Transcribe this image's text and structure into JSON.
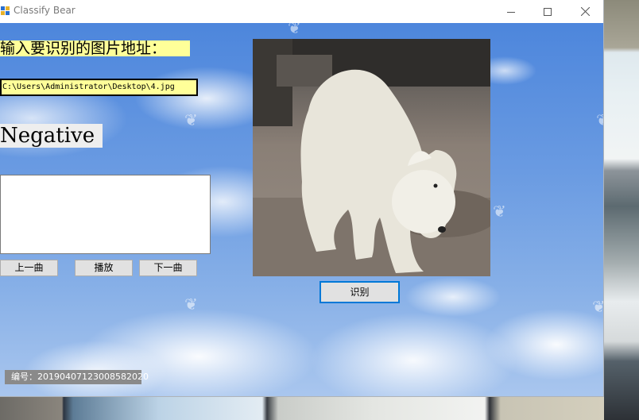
{
  "window": {
    "title": "Classify Bear",
    "minimize_icon": "minimize-icon",
    "maximize_icon": "maximize-icon",
    "close_icon": "close-icon"
  },
  "form": {
    "prompt_label": "输入要识别的图片地址：",
    "path_value": "C:\\Users\\Administrator\\Desktop\\4.jpg",
    "result_label": "Negative",
    "textbox_value": ""
  },
  "buttons": {
    "prev": "上一曲",
    "play": "播放",
    "next": "下一曲",
    "recognize": "识别"
  },
  "serial": "编号：20190407123008582020",
  "colors": {
    "label_highlight": "#ffff99",
    "accent": "#0078d7",
    "sky": "#6a9be2"
  }
}
